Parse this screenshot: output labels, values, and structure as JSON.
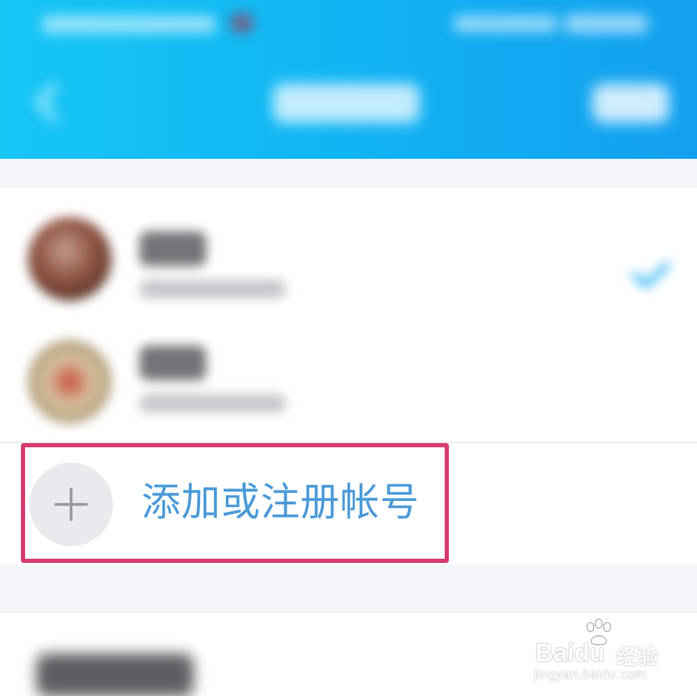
{
  "add_account": {
    "label": "添加或注册帐号",
    "icon": "plus-icon"
  },
  "highlight": {
    "color": "#d63a6e"
  },
  "colors": {
    "header_gradient_start": "#16c6f5",
    "header_gradient_end": "#139ff0",
    "link_blue": "#4a9ad8"
  },
  "watermark": {
    "brand": "Bai",
    "brand_tail": "du",
    "cn": "经验",
    "url": "jingyan.baidu.com"
  }
}
